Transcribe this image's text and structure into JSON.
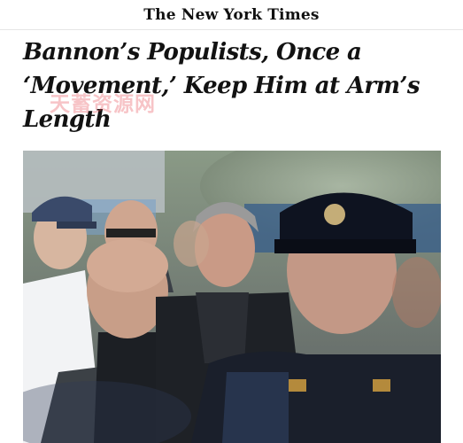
{
  "masthead": {
    "logo_text": "The New York Times"
  },
  "article": {
    "headline": "Bannon’s Populists, Once a ‘Movement,’ Keep Him at Arm’s Length",
    "watermark": "天蓄资源网",
    "photo_icon": "news-photo-crowd-with-police-officer"
  },
  "colors": {
    "headline": "#121212",
    "watermark": "#e64650",
    "background": "#ffffff"
  }
}
